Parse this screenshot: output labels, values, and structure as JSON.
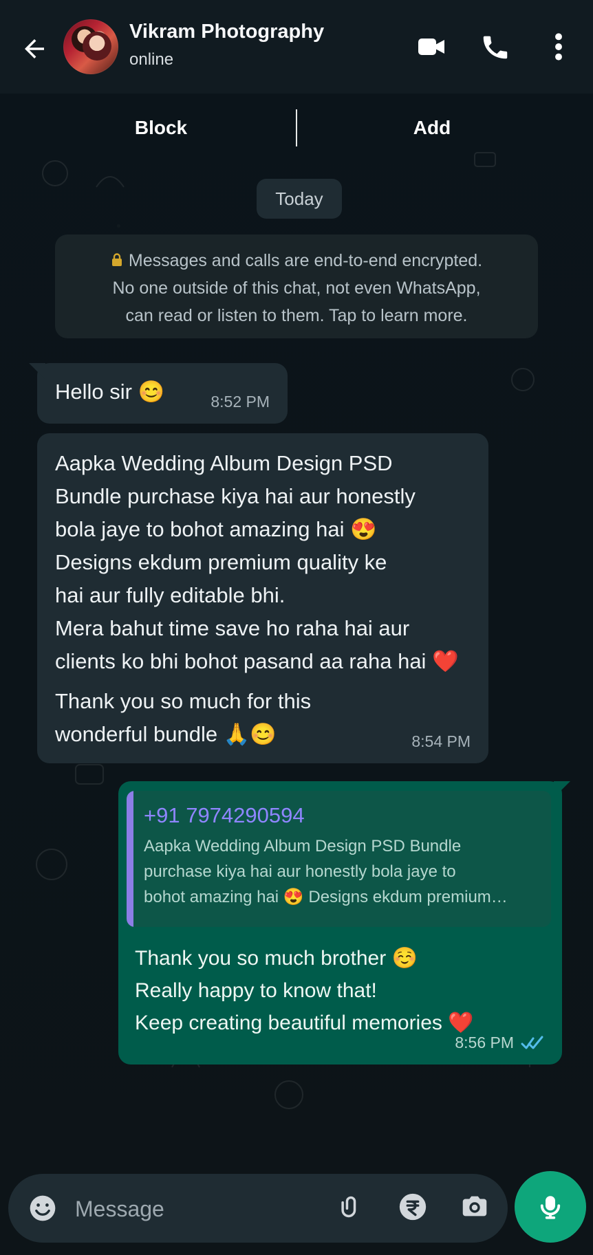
{
  "header": {
    "contact_name": "Vikram Photography",
    "status": "online",
    "icons": {
      "back": "arrow-left-icon",
      "video": "video-camera-icon",
      "call": "phone-icon",
      "menu": "more-vertical-icon"
    }
  },
  "actions": {
    "block": "Block",
    "add": "Add"
  },
  "chat": {
    "date": "Today",
    "encryption": {
      "line1": "Messages and calls are end-to-end encrypted.",
      "line2": "No one outside of this chat, not even WhatsApp,",
      "line3": "can read or listen to them. Tap to learn more."
    },
    "messages": [
      {
        "text": "Hello sir 😊",
        "time": "8:52 PM"
      },
      {
        "text": "Aapka Wedding Album Design PSD\nBundle purchase kiya hai aur honestly\nbola jaye to bohot amazing hai 😍\nDesigns ekdum premium quality ke\nhai aur fully editable bhi.\nMera bahut time save ho raha hai aur\nclients ko bhi bohot pasand aa raha hai ❤️",
        "text2": "Thank you so much for this\nwonderful bundle 🙏😊",
        "time": "8:54 PM"
      },
      {
        "quoted_sender": "+91 7974290594",
        "quoted_text": "Aapka Wedding Album Design PSD Bundle\npurchase kiya hai aur honestly bola jaye to\nbohot amazing hai 😍 Designs ekdum premium…",
        "text": "Thank you so much brother ☺️\nReally happy to know that!\nKeep creating beautiful memories ❤️",
        "time": "8:56 PM"
      }
    ]
  },
  "composer": {
    "placeholder": "Message",
    "icons": {
      "emoji": "emoji-icon",
      "attach": "paperclip-icon",
      "payment": "rupee-icon",
      "camera": "camera-icon",
      "mic": "microphone-icon"
    }
  },
  "colors": {
    "header_bg": "#111b21",
    "chat_bg": "#0b141a",
    "incoming_bubble": "#1f2c33",
    "outgoing_bubble": "#005c4b",
    "accent_green": "#0ea67b",
    "quote_accent": "#8c7ee6",
    "read_ticks": "#53bdeb"
  }
}
